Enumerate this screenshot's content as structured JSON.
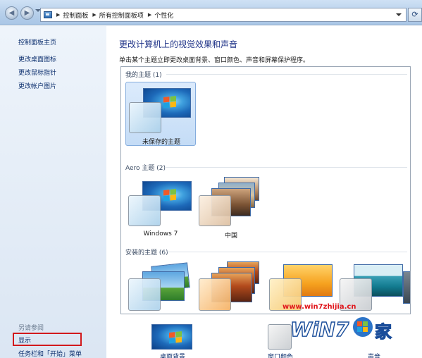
{
  "address_bar": {
    "crumbs": [
      "控制面板",
      "所有控制面板项",
      "个性化"
    ]
  },
  "sidebar": {
    "home_link": "控制面板主页",
    "links": [
      "更改桌面图标",
      "更改鼠标指针",
      "更改帐户图片"
    ],
    "see_also_heading": "另请参阅",
    "see_also_links": [
      "显示",
      "任务栏和「开始」菜单"
    ],
    "highlight_color": "#d2191c"
  },
  "main": {
    "title": "更改计算机上的视觉效果和声音",
    "description": "单击某个主题立即更改桌面背景、窗口颜色、声音和屏幕保护程序。",
    "groups": [
      {
        "label": "我的主题 (1)",
        "themes": [
          {
            "name": "未保存的主题",
            "selected": true
          }
        ]
      },
      {
        "label": "Aero 主题 (2)",
        "themes": [
          {
            "name": "Windows 7"
          },
          {
            "name": "中国"
          }
        ]
      },
      {
        "label": "安装的主题 (6)",
        "themes": []
      }
    ]
  },
  "bottom_row": {
    "items": [
      {
        "label": "桌面背景",
        "icon": "wallpaper-icon"
      },
      {
        "label": "窗口颜色",
        "icon": "window-color-icon"
      },
      {
        "label": "声音",
        "icon": "sound-icon"
      }
    ]
  },
  "watermark": {
    "url": "www.win7zhijia.cn",
    "logo_text": "WiN7",
    "logo_char": "家"
  },
  "colors": {
    "link": "#0c2f6e",
    "title": "#1e3287",
    "accent_red": "#e0151b"
  }
}
